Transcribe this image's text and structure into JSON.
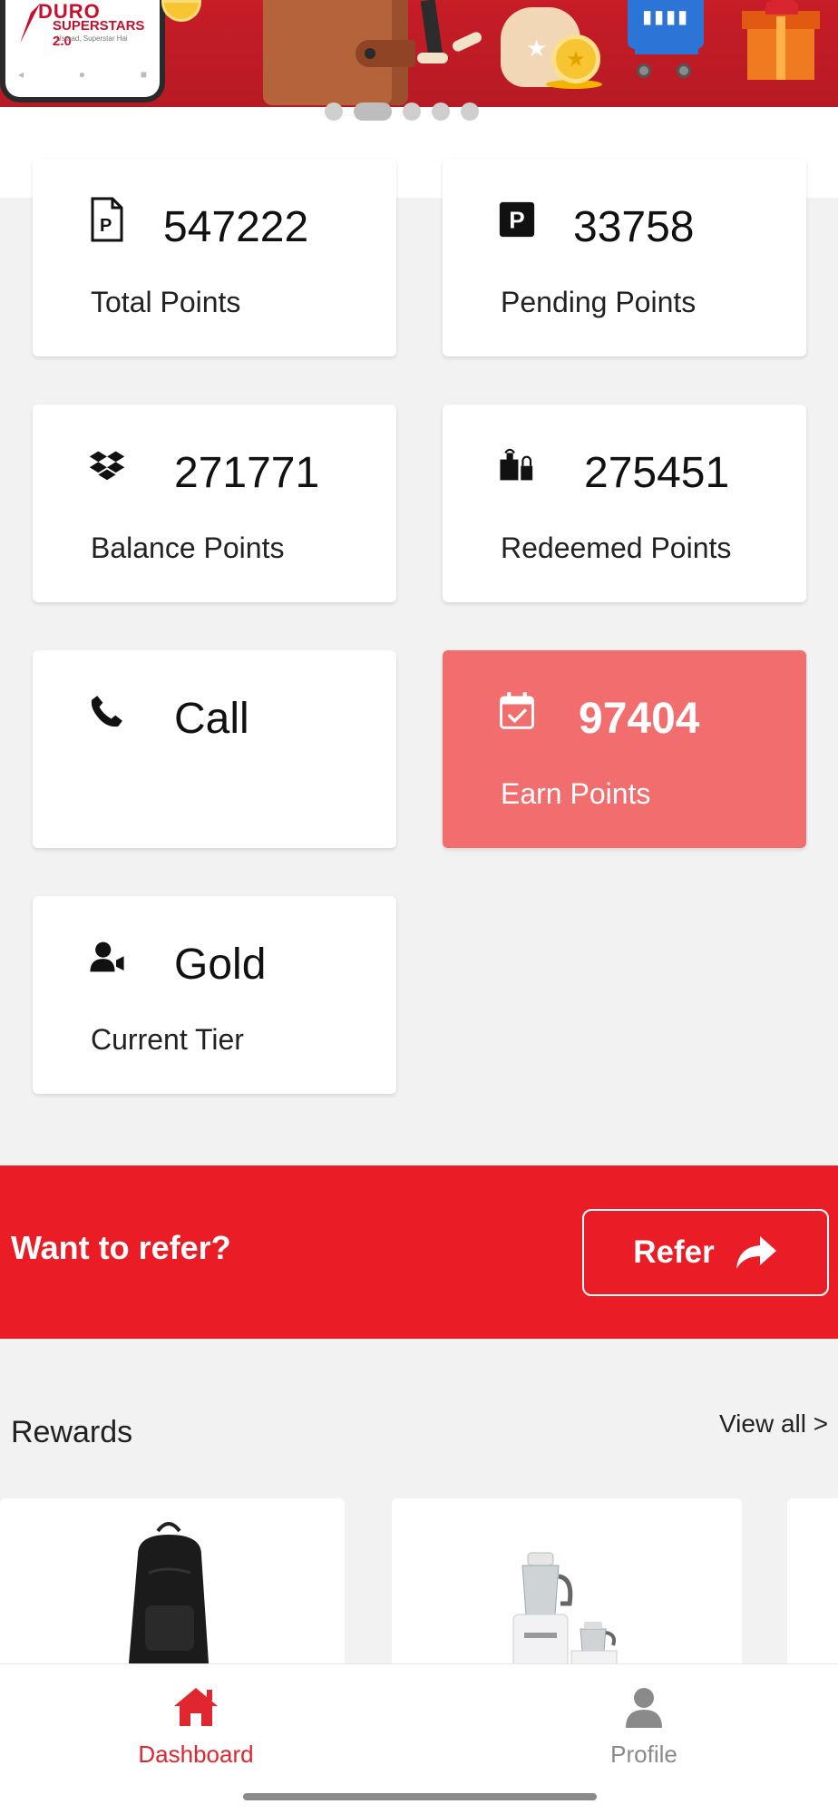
{
  "banner": {
    "logo_title": "DURO",
    "logo_subtitle": "SUPERSTARS 2.0",
    "logo_tagline": "Ustaad, Superstar Hai",
    "carousel_dots": 5,
    "carousel_active_index": 1
  },
  "stats": [
    {
      "icon": "document-p-icon",
      "value": "547222",
      "label": "Total Points"
    },
    {
      "icon": "parking-p-icon",
      "value": "33758",
      "label": "Pending Points"
    },
    {
      "icon": "dropbox-icon",
      "value": "271771",
      "label": "Balance Points"
    },
    {
      "icon": "gift-lock-icon",
      "value": "275451",
      "label": "Redeemed Points"
    },
    {
      "icon": "phone-icon",
      "value": "Call",
      "label": ""
    },
    {
      "icon": "calendar-check-icon",
      "value": "97404",
      "label": "Earn Points"
    },
    {
      "icon": "user-tier-icon",
      "value": "Gold",
      "label": "Current Tier"
    }
  ],
  "refer": {
    "prompt": "Want to refer?",
    "button_label": "Refer"
  },
  "rewards": {
    "title": "Rewards",
    "view_all": "View all >",
    "items": [
      {
        "image": "backpack"
      },
      {
        "image": "mixer-grinder"
      }
    ]
  },
  "nav": {
    "items": [
      {
        "label": "Dashboard",
        "icon": "home-icon",
        "active": true
      },
      {
        "label": "Profile",
        "icon": "person-icon",
        "active": false
      }
    ]
  },
  "colors": {
    "brand_red": "#ea1c26",
    "earn_card": "#f26d6d",
    "nav_active": "#e0262f",
    "nav_inactive": "#888888"
  }
}
